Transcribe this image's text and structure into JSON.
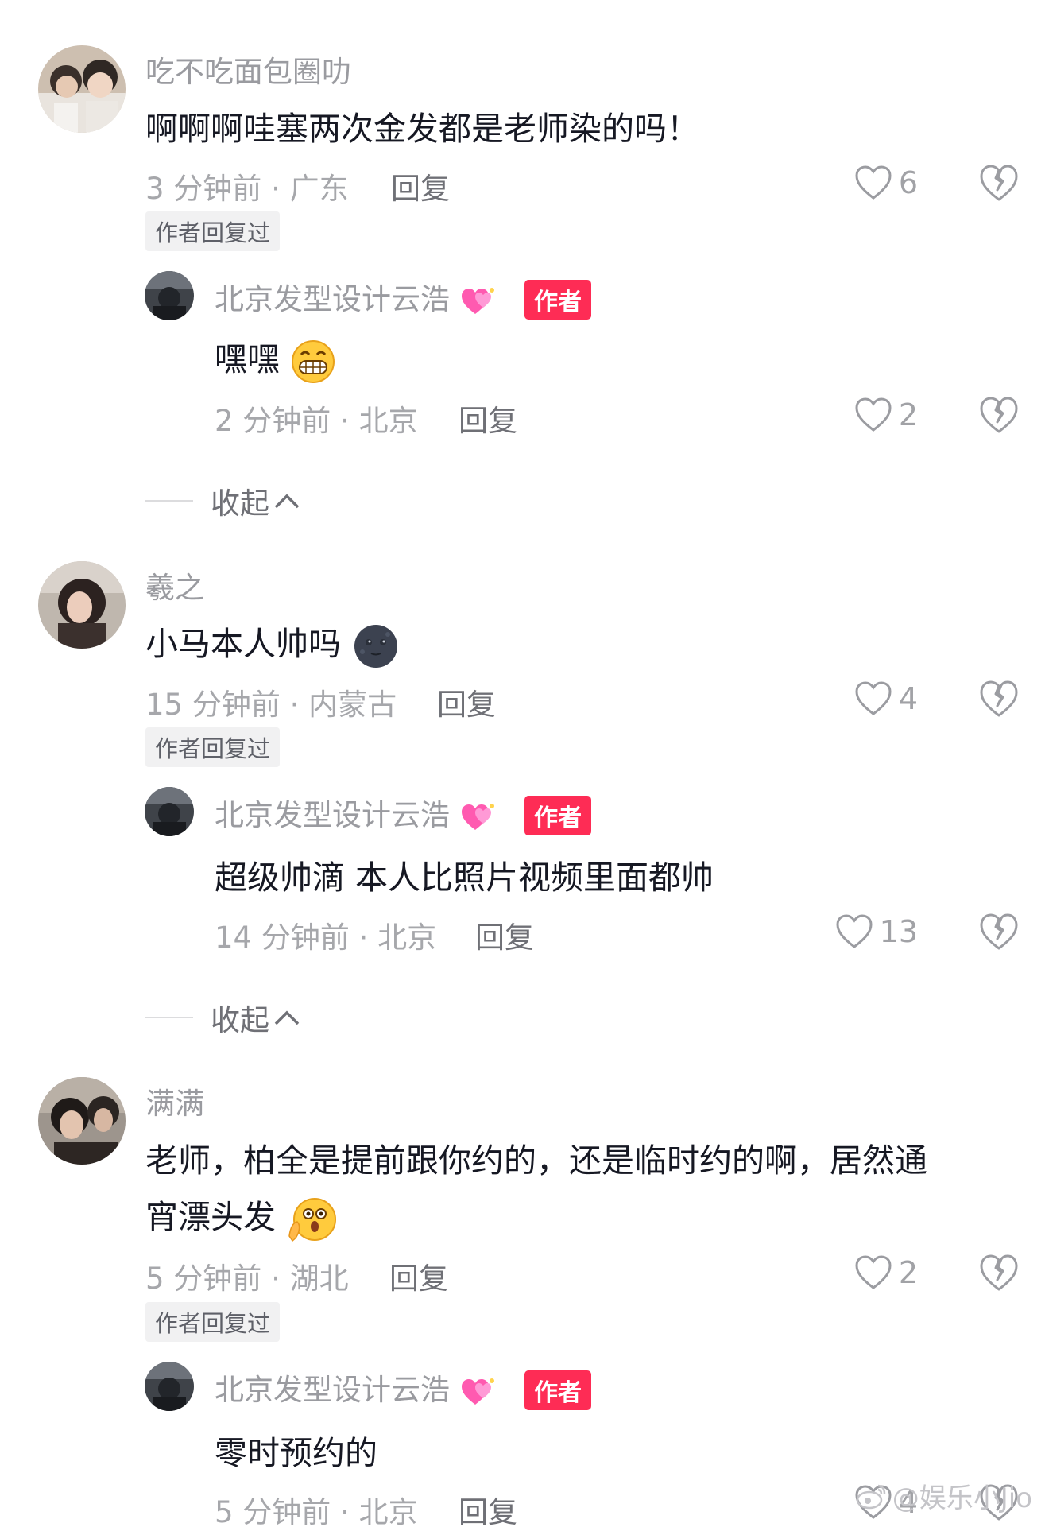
{
  "comments": [
    {
      "user": "吃不吃面包圈叻",
      "text": "啊啊啊哇塞两次金发都是老师染的吗！",
      "meta": "3 分钟前 · 广东",
      "reply_label": "回复",
      "likes": "6",
      "author_replied": "作者回复过",
      "reply": {
        "user": "北京发型设计云浩",
        "badge": "作者",
        "text": "嘿嘿",
        "meta": "2 分钟前 · 北京",
        "reply_label": "回复",
        "likes": "2"
      },
      "collapse": "收起"
    },
    {
      "user": "羲之",
      "text": "小马本人帅吗",
      "meta": "15 分钟前 · 内蒙古",
      "reply_label": "回复",
      "likes": "4",
      "author_replied": "作者回复过",
      "reply": {
        "user": "北京发型设计云浩",
        "badge": "作者",
        "text": "超级帅滴 本人比照片视频里面都帅",
        "meta": "14 分钟前 · 北京",
        "reply_label": "回复",
        "likes": "13"
      },
      "collapse": "收起"
    },
    {
      "user": "满满",
      "text_line1": "老师，柏全是提前跟你约的，还是临时约的啊，居然通",
      "text_line2": "宵漂头发",
      "meta": "5 分钟前 · 湖北",
      "reply_label": "回复",
      "likes": "2",
      "author_replied": "作者回复过",
      "reply": {
        "user": "北京发型设计云浩",
        "badge": "作者",
        "text": "零时预约的",
        "meta": "5 分钟前 · 北京",
        "reply_label": "回复",
        "likes": "4"
      }
    }
  ],
  "watermark": "@娱乐小Jio",
  "colors": {
    "badge": "#fe2c55",
    "muted": "#a6a7ab",
    "text": "#161823"
  }
}
